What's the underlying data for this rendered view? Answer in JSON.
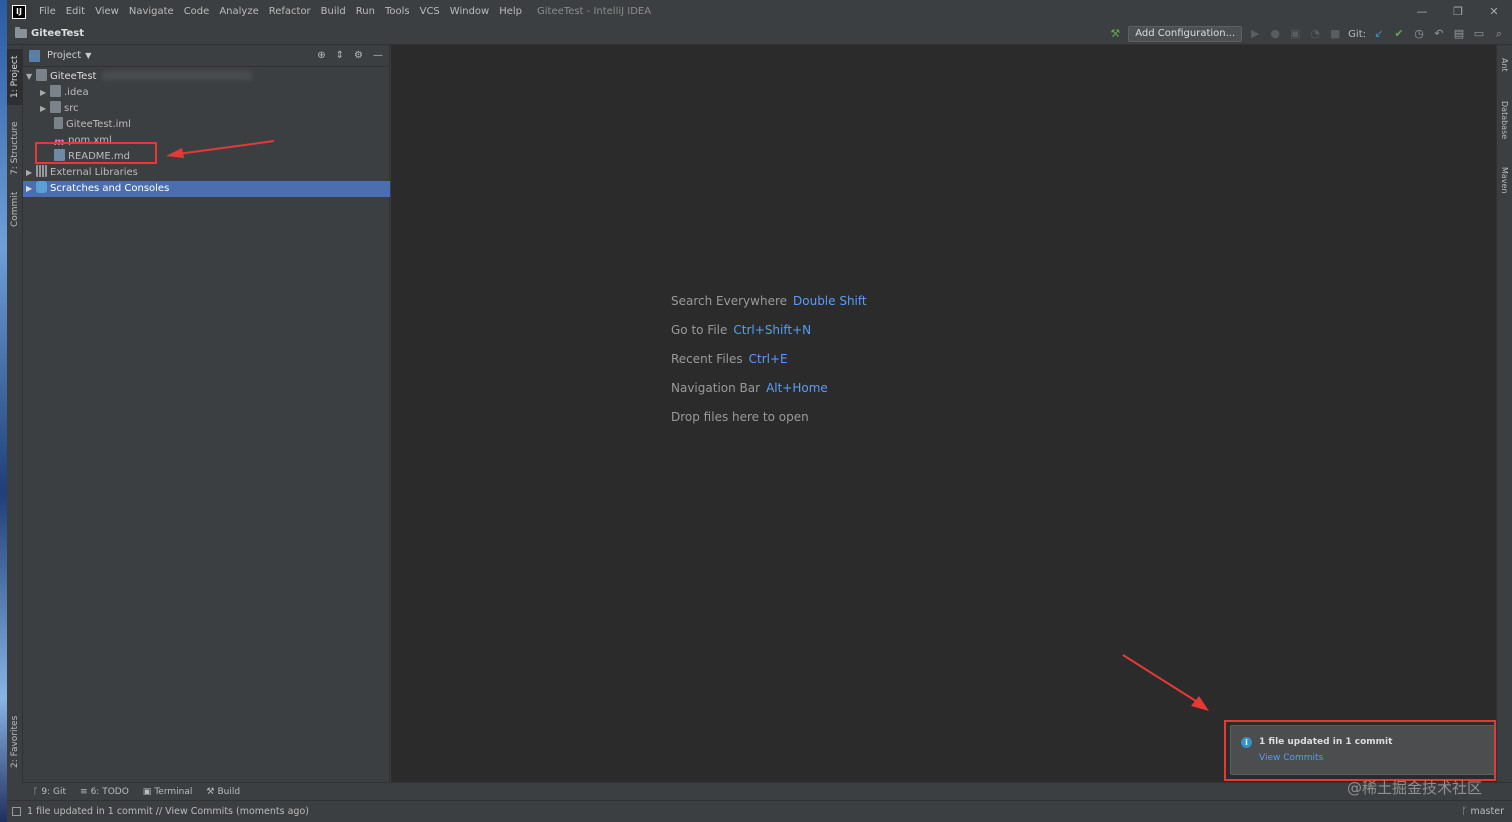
{
  "app": {
    "logo_text": "IJ",
    "window_title": "GiteeTest - IntelliJ IDEA"
  },
  "menu": [
    "File",
    "Edit",
    "View",
    "Navigate",
    "Code",
    "Analyze",
    "Refactor",
    "Build",
    "Run",
    "Tools",
    "VCS",
    "Window",
    "Help"
  ],
  "window_controls": {
    "minimize": "—",
    "restore": "❐",
    "close": "✕"
  },
  "navbar": {
    "breadcrumb": "GiteeTest",
    "add_configuration": "Add Configuration...",
    "git_label": "Git:"
  },
  "left_tools": {
    "project": "1: Project",
    "structure": "7: Structure",
    "commit": "Commit",
    "favorites": "2: Favorites"
  },
  "right_tools": {
    "ant": "Ant",
    "database": "Database",
    "maven": "Maven"
  },
  "project_pane": {
    "title": "Project",
    "tree": [
      {
        "label": "GiteeTest",
        "depth": 0,
        "arrow": "▼",
        "icon": "folder"
      },
      {
        "label": ".idea",
        "depth": 1,
        "arrow": "▶",
        "icon": "folder"
      },
      {
        "label": "src",
        "depth": 1,
        "arrow": "▶",
        "icon": "folder"
      },
      {
        "label": "GiteeTest.iml",
        "depth": 1,
        "arrow": "",
        "icon": "file"
      },
      {
        "label": "pom.xml",
        "depth": 1,
        "arrow": "",
        "icon": "maven"
      },
      {
        "label": "README.md",
        "depth": 1,
        "arrow": "",
        "icon": "markdown"
      },
      {
        "label": "External Libraries",
        "depth": 0,
        "arrow": "▶",
        "icon": "library"
      },
      {
        "label": "Scratches and Consoles",
        "depth": 0,
        "arrow": "▶",
        "icon": "scratch",
        "selected": true
      }
    ]
  },
  "editor_hints": [
    {
      "label": "Search Everywhere",
      "shortcut": "Double Shift"
    },
    {
      "label": "Go to File",
      "shortcut": "Ctrl+Shift+N"
    },
    {
      "label": "Recent Files",
      "shortcut": "Ctrl+E"
    },
    {
      "label": "Navigation Bar",
      "shortcut": "Alt+Home"
    },
    {
      "label": "Drop files here to open",
      "shortcut": ""
    }
  ],
  "notification": {
    "title": "1 file updated in 1 commit",
    "link": "View Commits"
  },
  "bottom_tabs": [
    "9: Git",
    "6: TODO",
    "Terminal",
    "Build"
  ],
  "status": {
    "message": "1 file updated in 1 commit // View Commits (moments ago)",
    "branch": "master"
  },
  "watermark": "@稀土掘金技术社区"
}
